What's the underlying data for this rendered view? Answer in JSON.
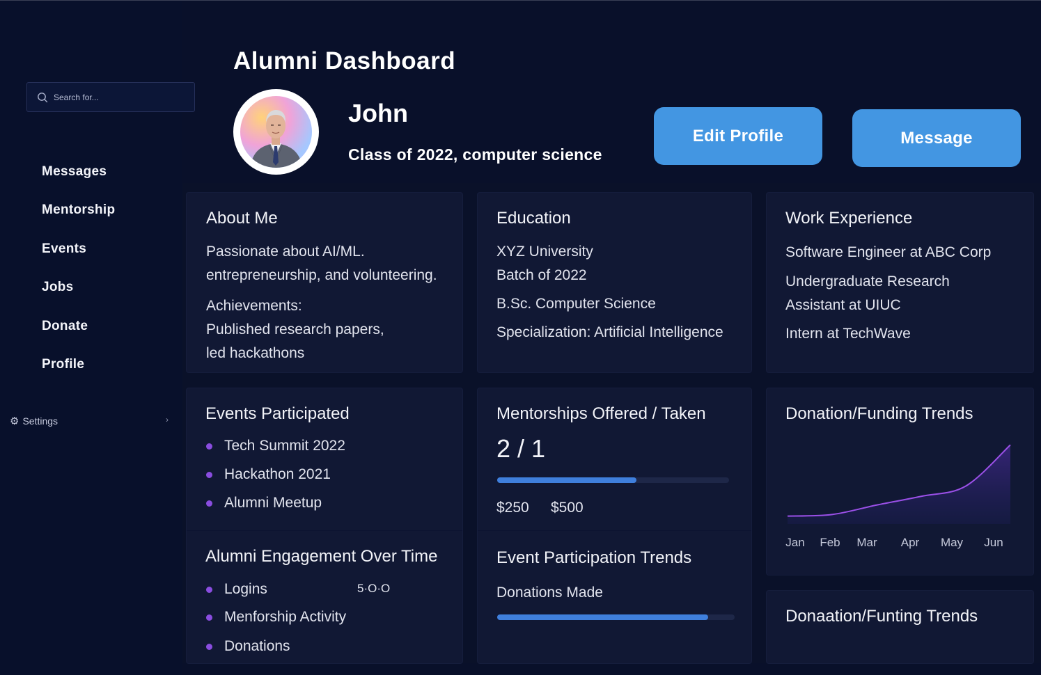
{
  "sidebar": {
    "search_placeholder": "Search for...",
    "nav": [
      "Messages",
      "Mentorship",
      "Events",
      "Jobs",
      "Donate",
      "Profile"
    ],
    "settings_label": "Settings"
  },
  "header": {
    "title": "Alumni Dashboard",
    "name": "John",
    "class_line": "Class of 2022, computer science",
    "edit_profile": "Edit Profile",
    "message": "Message"
  },
  "about": {
    "title": "About Me",
    "line1": "Passionate about AI/ML.",
    "line2": "entrepreneurship, and volunteering.",
    "achievements_label": "Achievements:",
    "achievements_line1": "Published research papers,",
    "achievements_line2": "led hackathons"
  },
  "education": {
    "title": "Education",
    "university": "XYZ University",
    "batch": "Batch of 2022",
    "degree": "B.Sc. Computer Science",
    "specialization": "Specialization: Artificial Intelligence"
  },
  "work": {
    "title": "Work Experience",
    "job1": "Software Engineer at ABC Corp",
    "job2_line1": "Undergraduate Research",
    "job2_line2": "Assistant at UIUC",
    "job3": "Intern at TechWave"
  },
  "events": {
    "title": "Events Participated",
    "items": [
      "Tech Summit 2022",
      "Hackathon 2021",
      "Alumni Meetup"
    ]
  },
  "engagement": {
    "title": "Alumni Engagement Over Time",
    "items": [
      "Logins",
      "Menforship Activity",
      "Donations"
    ],
    "logins_value": "5·O·O"
  },
  "mentorships": {
    "title": "Mentorships Offered / Taken",
    "ratio": "2 / 1",
    "progress": 0.6,
    "amount1": "$250",
    "amount2": "$500"
  },
  "event_trends": {
    "title": "Event Participation Trends",
    "subtitle": "Donations Made",
    "progress": 0.89
  },
  "donation_trends": {
    "title": "Donation/Funding Trends"
  },
  "donation_trends_2": {
    "title": "Donaation/Funting Trends"
  },
  "colors": {
    "background": "#09102a",
    "card": "#111834",
    "accent_button": "#4396e2",
    "bullet": "#8a4de0",
    "progress": "#3f7fdc",
    "chart_line": "#9b50e8"
  },
  "icons": {
    "search": "search-icon",
    "settings": "gear-icon",
    "settings_chevron": "chevron-right-icon"
  },
  "chart_data": {
    "type": "area",
    "title": "Donation/Funding Trends",
    "categories": [
      "Jan",
      "Feb",
      "Mar",
      "Apr",
      "May",
      "Jun"
    ],
    "series": [
      {
        "values": [
          10,
          12,
          24,
          35,
          48,
          100
        ]
      }
    ],
    "xlabel": "",
    "ylabel": "",
    "ylim": [
      0,
      110
    ],
    "grid": false,
    "legend": "none"
  }
}
